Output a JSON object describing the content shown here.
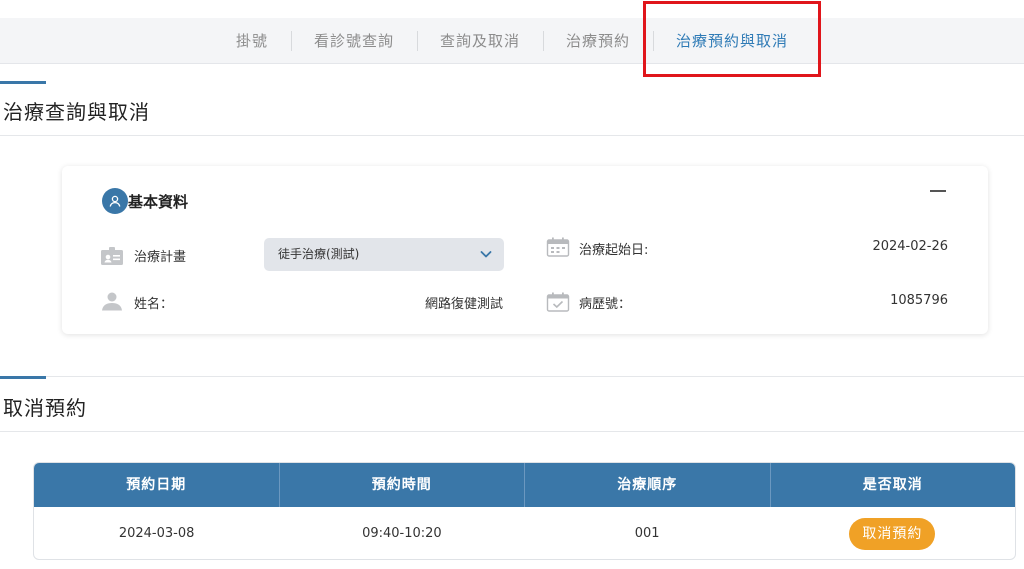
{
  "nav": {
    "tabs": [
      {
        "label": "掛號"
      },
      {
        "label": "看診號查詢"
      },
      {
        "label": "查詢及取消"
      },
      {
        "label": "治療預約"
      },
      {
        "label": "治療預約與取消"
      }
    ]
  },
  "section1": {
    "title": "治療查詢與取消"
  },
  "card": {
    "title": "基本資料",
    "fields": {
      "plan_label": "治療計畫",
      "plan_value": "徒手治療(測試)",
      "start_label": "治療起始日:",
      "start_value": "2024-02-26",
      "name_label": "姓名：",
      "name_value": "網路復健測試",
      "record_label": "病歷號：",
      "record_value": "1085796"
    }
  },
  "section2": {
    "title": "取消預約"
  },
  "table": {
    "headers": [
      "預約日期",
      "預約時間",
      "治療順序",
      "是否取消"
    ],
    "rows": [
      {
        "date": "2024-03-08",
        "time": "09:40-10:20",
        "order": "001",
        "action": "取消預約"
      }
    ]
  },
  "colors": {
    "accent": "#3a77a8",
    "active_tab": "#2f7bb6",
    "highlight_border": "#e0151b",
    "cancel_button": "#f0a126"
  }
}
